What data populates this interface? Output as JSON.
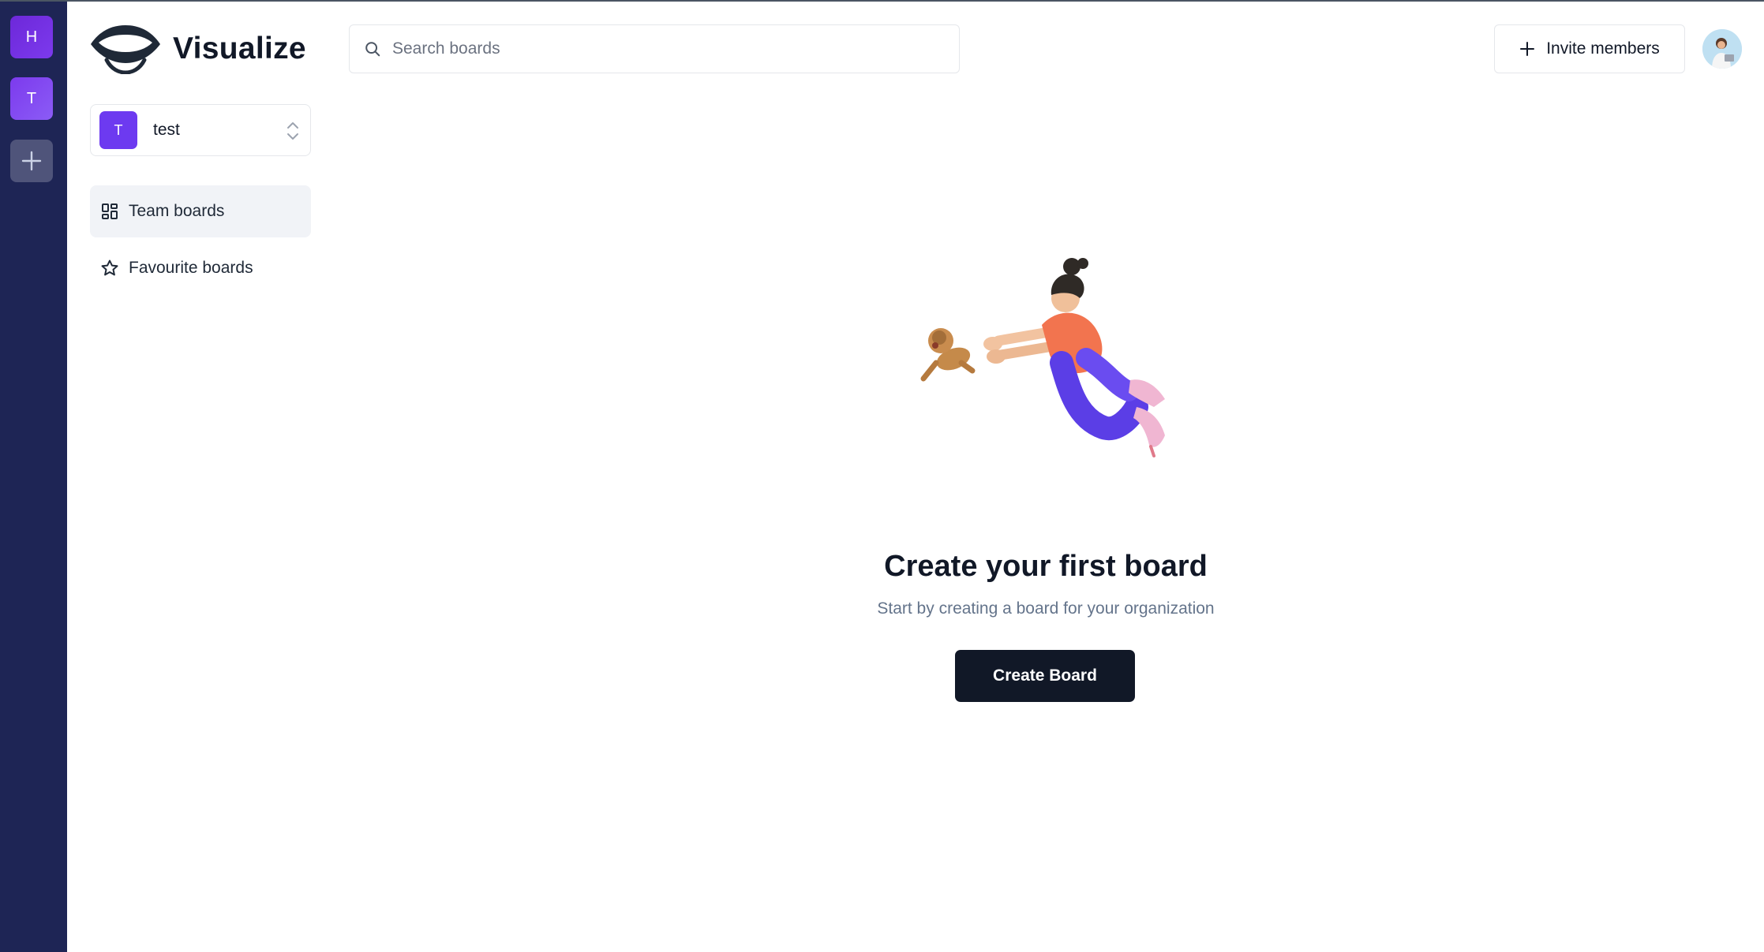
{
  "rail": {
    "orgs": [
      {
        "initial": "H"
      },
      {
        "initial": "T"
      }
    ],
    "add_icon": "plus-icon"
  },
  "brand": {
    "name": "Visualize",
    "logo_icon": "eye-logo-icon"
  },
  "org_switcher": {
    "initial": "T",
    "name": "test",
    "icon": "chevron-up-down-icon"
  },
  "nav": {
    "items": [
      {
        "label": "Team boards",
        "icon": "dashboard-grid-icon",
        "active": true
      },
      {
        "label": "Favourite boards",
        "icon": "star-icon",
        "active": false
      }
    ]
  },
  "search": {
    "placeholder": "Search boards",
    "value": ""
  },
  "header": {
    "invite_label": "Invite members",
    "avatar_icon": "user-avatar"
  },
  "empty_state": {
    "title": "Create your first board",
    "subtitle": "Start by creating a board for your organization",
    "button_label": "Create Board",
    "illustration": "person-chasing-dog-illustration"
  },
  "colors": {
    "rail_bg": "#1e2555",
    "accent": "#6d3af0",
    "primary_button": "#111827"
  }
}
